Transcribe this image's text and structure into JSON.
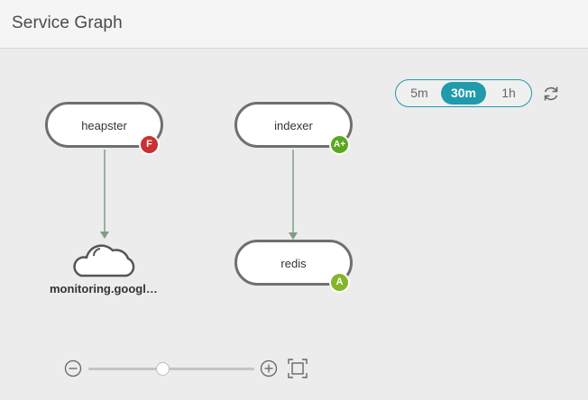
{
  "header": {
    "title": "Service Graph"
  },
  "time_range": {
    "options": [
      {
        "label": "5m",
        "active": false
      },
      {
        "label": "30m",
        "active": true
      },
      {
        "label": "1h",
        "active": false
      }
    ]
  },
  "toolbar": {
    "refresh_icon": "refresh-icon"
  },
  "colors": {
    "accent": "#1f9bab",
    "grade_F": "#c83232",
    "grade_A_plus": "#5aa81e",
    "grade_A": "#84b62c",
    "edge": "#7f9c84"
  },
  "nodes": {
    "heapster": {
      "label": "heapster",
      "grade": "F"
    },
    "indexer": {
      "label": "indexer",
      "grade": "A+"
    },
    "redis": {
      "label": "redis",
      "grade": "A"
    },
    "external": {
      "label": "monitoring.googl…",
      "icon": "cloud-icon"
    }
  },
  "zoom": {
    "zoom_out_icon": "zoom-out-icon",
    "zoom_in_icon": "zoom-in-icon",
    "fit_icon": "fit-screen-icon",
    "level": 0.45
  }
}
